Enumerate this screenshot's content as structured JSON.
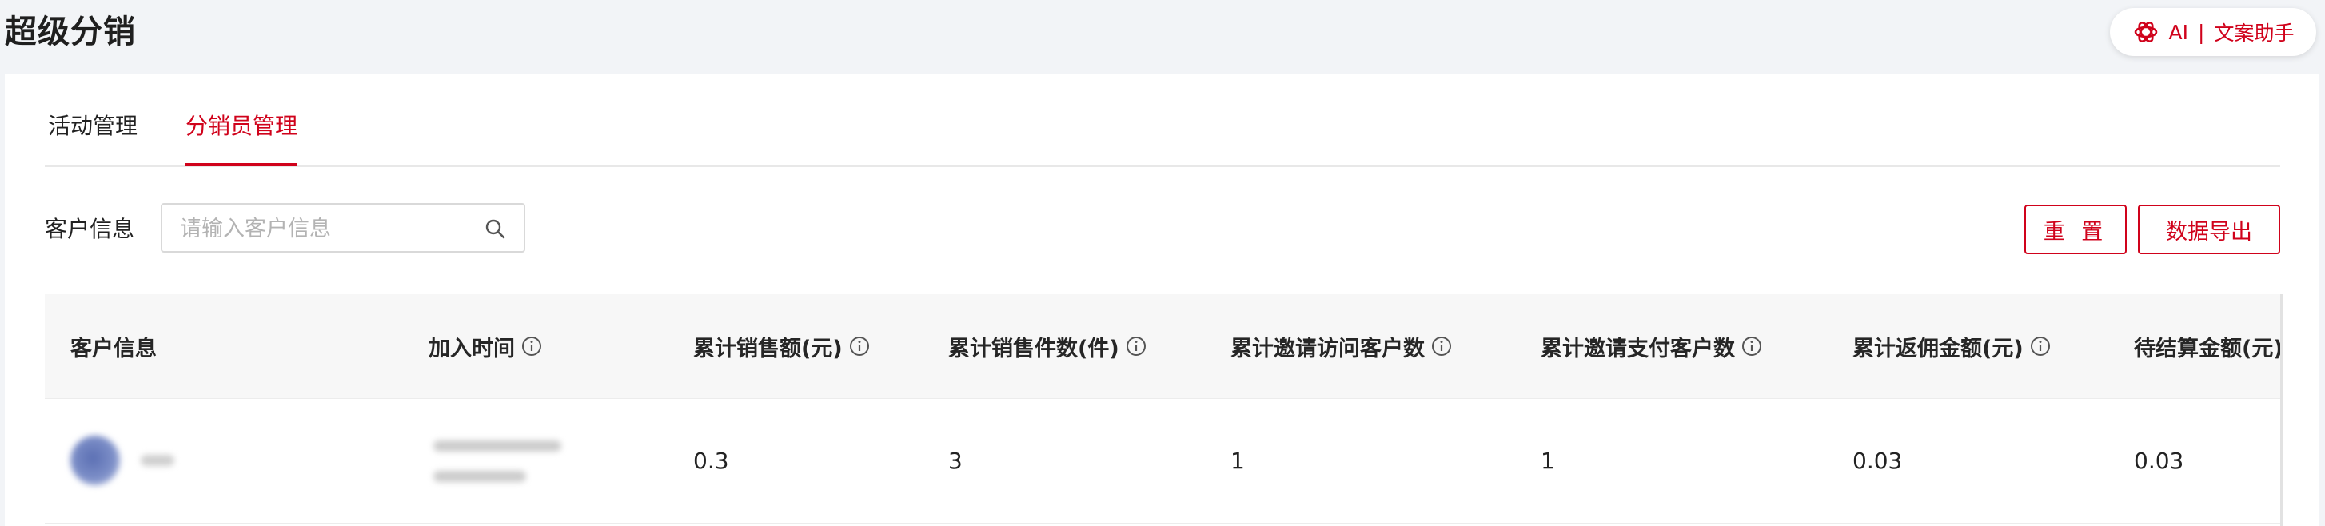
{
  "header": {
    "title": "超级分销",
    "ai_button": {
      "ai_label": "AI",
      "separator": "|",
      "assistant_label": "文案助手"
    }
  },
  "tabs": [
    {
      "label": "活动管理",
      "active": false
    },
    {
      "label": "分销员管理",
      "active": true
    }
  ],
  "filter": {
    "label": "客户信息",
    "search_placeholder": "请输入客户信息",
    "search_value": "",
    "reset_label": "重 置",
    "export_label": "数据导出"
  },
  "table": {
    "columns": [
      {
        "label": "客户信息",
        "has_info": false
      },
      {
        "label": "加入时间",
        "has_info": true
      },
      {
        "label": "累计销售额(元)",
        "has_info": true
      },
      {
        "label": "累计销售件数(件)",
        "has_info": true
      },
      {
        "label": "累计邀请访问客户数",
        "has_info": true
      },
      {
        "label": "累计邀请支付客户数",
        "has_info": true
      },
      {
        "label": "累计返佣金额(元)",
        "has_info": true
      },
      {
        "label": "待结算金额(元)",
        "has_info": true
      }
    ],
    "rows": [
      {
        "customer_info": "",
        "join_time": "",
        "total_sales": "0.3",
        "total_items": "3",
        "invited_visitors": "1",
        "invited_payers": "1",
        "total_commission": "0.03",
        "pending_settlement": "0.03"
      }
    ]
  },
  "colors": {
    "accent": "#d0021b",
    "page_bg": "#f2f4f7",
    "header_row_bg": "#f7f7f7"
  },
  "icons": {
    "ai": "ai-logo-icon",
    "search": "search-icon",
    "info": "info-icon"
  }
}
